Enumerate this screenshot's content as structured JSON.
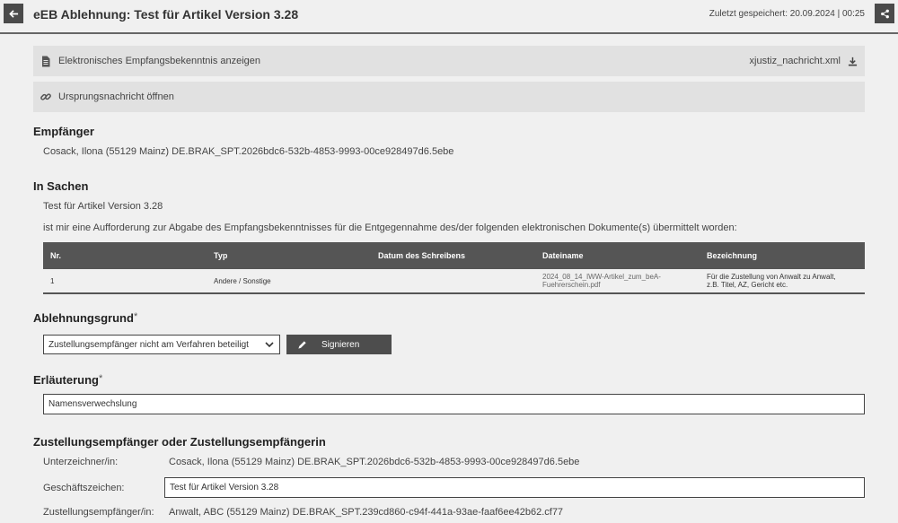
{
  "header": {
    "title": "eEB Ablehnung: Test für Artikel Version 3.28",
    "saved_status": "Zuletzt gespeichert: 20.09.2024 | 00:25"
  },
  "actions": {
    "show_receipt_label": "Elektronisches Empfangsbekenntnis anzeigen",
    "xml_filename": "xjustiz_nachricht.xml",
    "open_origin_label": "Ursprungsnachricht öffnen"
  },
  "recipient": {
    "heading": "Empfänger",
    "value": "Cosack, Ilona (55129 Mainz) DE.BRAK_SPT.2026bdc6-532b-4853-9993-00ce928497d6.5ebe"
  },
  "matter": {
    "heading": "In Sachen",
    "subject": "Test für Artikel Version 3.28",
    "description": "ist mir eine Aufforderung zur Abgabe des Empfangsbekenntnisses für die Entgegennahme des/der folgenden elektronischen Dokumente(s) übermittelt worden:"
  },
  "documents": {
    "headers": [
      "Nr.",
      "Typ",
      "Datum des Schreibens",
      "Dateiname",
      "Bezeichnung"
    ],
    "rows": [
      {
        "nr": "1",
        "typ": "Andere / Sonstige",
        "datum": "",
        "dateiname_1": "2024_08_14_IWW-Artikel_zum_beA-",
        "dateiname_2": "Fuehrerschein.pdf",
        "bezeichnung_1": "Für die Zustellung von Anwalt zu Anwalt,",
        "bezeichnung_2": "z.B. Titel, AZ, Gericht etc."
      }
    ]
  },
  "rejection": {
    "heading": "Ablehnungsgrund",
    "required_mark": "*",
    "selected": "Zustellungsempfänger nicht am Verfahren beteiligt",
    "sign_label": "Signieren"
  },
  "explanation": {
    "heading": "Erläuterung",
    "required_mark": "*",
    "value": "Namensverwechslung"
  },
  "recipient_details": {
    "heading": "Zustellungsempfänger oder Zustellungsempfängerin",
    "signer_label": "Unterzeichner/in:",
    "signer_value": "Cosack, Ilona (55129 Mainz) DE.BRAK_SPT.2026bdc6-532b-4853-9993-00ce928497d6.5ebe",
    "ref_label": "Geschäftszeichen:",
    "ref_value": "Test für Artikel Version 3.28",
    "recipient_label": "Zustellungsempfänger/in:",
    "recipient_value": "Anwalt, ABC (55129 Mainz) DE.BRAK_SPT.239cd860-c94f-441a-93ae-faaf6ee42b62.cf77"
  }
}
